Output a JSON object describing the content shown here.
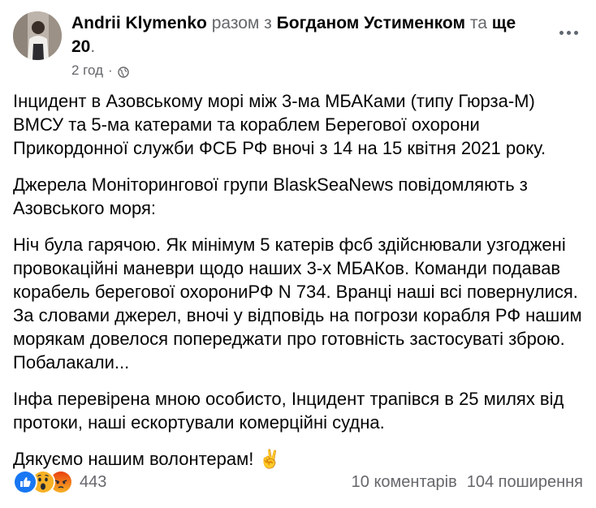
{
  "post": {
    "author": "Andrii Klymenko",
    "with_text": "разом з",
    "tagged": "Богданом Устименком",
    "and_text": "та",
    "others": "ще 20",
    "others_suffix": ".",
    "time": "2 год",
    "dot": "·",
    "paragraphs": [
      "Інцидент в Азовському морі між 3-ма МБАКами (типу Гюрза-М) ВМСУ та 5-ма катерами та кораблем Берегової охорони Прикордонної служби ФСБ РФ вночі з 14 на 15 квітня 2021 року.",
      "Джерела Моніторингової групи BlaskSeaNews повідомляють з Азовського моря:",
      "Ніч була гарячою. Як мінімум 5 катерів фсб здійснювали узгоджені провокаційні маневри щодо наших 3-х МБАКов. Команди подавав корабель берегової охорониРФ N 734. Вранці наші всі повернулися. За словами джерел, вночі у відповідь на погрози корабля РФ нашим морякам довелося попереджати про готовність застосуваті зброю. Побалакали...",
      "Інфа перевірена мною особисто, Інцидент трапівся в 25 милях від протоки, наші ескортували комерційні судна.",
      "Дякуємо нашим волонтерам! ✌️"
    ],
    "reactions": [
      "like-reaction",
      "wow-reaction",
      "angry-reaction"
    ],
    "reaction_count": "443",
    "comments": "10 коментарів",
    "shares": "104 поширення"
  },
  "colors": {
    "like": "#1877f2",
    "wow": "#f7b125",
    "angry": "#e9710f",
    "muted": "#65676b"
  }
}
